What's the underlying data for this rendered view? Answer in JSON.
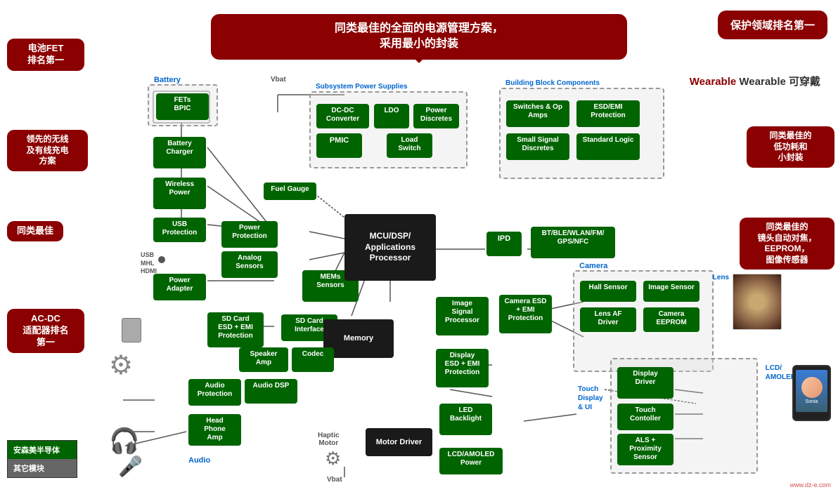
{
  "banners": {
    "top_center": "同类最佳的全面的电源管理方案，\n采用最小的封装",
    "top_right": "保护领域排名第一",
    "wearable": "Wearable  可穿戴"
  },
  "bubbles": {
    "battery_fet": "电池FET\n排名第一",
    "wireless_wired": "领先的无线\n及有线充电\n方案",
    "best_in_class": "同类最佳",
    "ac_dc": "AC-DC\n适配器排名\n第一",
    "low_power": "同类最佳的\n低功耗和\n小封装",
    "lens_af": "同类最佳的\n镜头自动对焦，\nEEPROM，\n图像传感器"
  },
  "subsystem_power": {
    "label": "Subsystem Power Supplies",
    "components": [
      "DC-DC Converter",
      "LDO",
      "Power Discretes",
      "PMIC",
      "Load Switch"
    ]
  },
  "building_block": {
    "label": "Building Block Components",
    "components": [
      "Switches & Op Amps",
      "ESD/EMI Protection",
      "Small Signal Discretes",
      "Standard Logic"
    ]
  },
  "battery_section": {
    "label": "Battery",
    "fets": "FETs\nBPIC"
  },
  "left_components": {
    "battery_charger": "Battery\nCharger",
    "wireless_power": "Wireless\nPower",
    "usb_protection": "USB\nProtection",
    "power_adapter": "Power\nAdapter",
    "fuel_gauge": "Fuel Gauge"
  },
  "middle_components": {
    "power_protection": "Power\nProtection",
    "analog_sensors": "Analog\nSensors",
    "mems_sensors": "MEMs\nSensors",
    "sd_card_esd": "SD Card\nESD + EMI\nProtection",
    "sd_card_interface": "SD Card\nInterface",
    "codec": "Codec",
    "speaker_amp": "Speaker\nAmp",
    "audio_dsp": "Audio DSP",
    "audio_protection": "Audio\nProtection",
    "head_phone_amp": "Head\nPhone\nAmp"
  },
  "center_components": {
    "mcu_dsp": "MCU/DSP/\nApplications\nProcessor",
    "memory": "Memory",
    "image_signal": "Image\nSignal\nProcessor",
    "motor_driver": "Motor Driver",
    "lcd_amoled_power": "LCD/AMOLED\nPower"
  },
  "right_center": {
    "ipd": "IPD",
    "bt_ble": "BT/BLE/WLAN/FM/\nGPS/NFC",
    "camera_esd": "Camera ESD\n+ EMI\nProtection",
    "display_esd": "Display\nESD + EMI\nProtection",
    "led_backlight": "LED\nBacklight"
  },
  "right_components": {
    "camera_label": "Camera",
    "lens_label": "Lens",
    "hall_sensor": "Hall Sensor",
    "image_sensor": "Image Sensor",
    "lens_af_driver": "Lens AF\nDriver",
    "camera_eeprom": "Camera\nEEPROM",
    "display_driver": "Display\nDriver",
    "touch_controller": "Touch\nContoller",
    "als_proximity": "ALS +\nProximity\nSensor",
    "lcd_amoled_label": "LCD/\nAMOLED",
    "touch_display": "Touch\nDisplay\n& UI"
  },
  "audio": {
    "label": "Audio",
    "haptic_motor": "Haptic\nMotor",
    "vbat_top": "Vbat",
    "vbat_bottom": "Vbat"
  },
  "connectors": {
    "usb_mhl_hdmi": "USB\nMHL\nHDMI"
  },
  "legend": {
    "item1": "安森美半导体",
    "item2": "其它模块"
  }
}
